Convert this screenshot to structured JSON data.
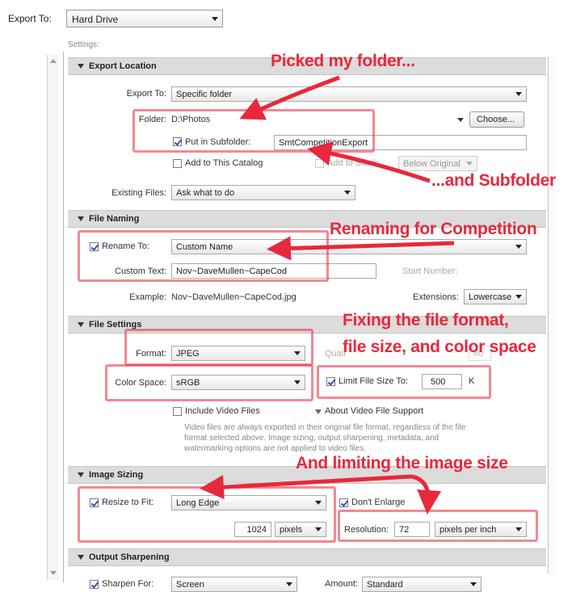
{
  "header": {
    "export_to_label": "Export To:",
    "export_to_value": "Hard Drive",
    "settings_label": "Settings:"
  },
  "sections": {
    "export_location": "Export Location",
    "file_naming": "File Naming",
    "file_settings": "File Settings",
    "image_sizing": "Image Sizing",
    "output_sharpening": "Output Sharpening"
  },
  "export_location": {
    "export_to_label": "Export To:",
    "export_to_value": "Specific folder",
    "folder_label": "Folder:",
    "folder_value": "D:\\Photos",
    "choose_button": "Choose...",
    "put_in_subfolder_label": "Put in Subfolder:",
    "subfolder_value": "SmtCompetitionExport",
    "add_to_catalog_label": "Add to This Catalog",
    "add_to_stack_label": "Add to Stack:",
    "below_original": "Below Original",
    "existing_files_label": "Existing Files:",
    "existing_files_value": "Ask what to do"
  },
  "file_naming": {
    "rename_to_label": "Rename To:",
    "rename_to_value": "Custom Name",
    "custom_text_label": "Custom Text:",
    "custom_text_value": "Nov~DaveMullen~CapeCod",
    "start_number_label": "Start Number:",
    "example_label": "Example:",
    "example_value": "Nov~DaveMullen~CapeCod.jpg",
    "extensions_label": "Extensions:",
    "extensions_value": "Lowercase"
  },
  "file_settings": {
    "format_label": "Format:",
    "format_value": "JPEG",
    "quality_label": "Quali",
    "quality_value": "60",
    "color_space_label": "Color Space:",
    "color_space_value": "sRGB",
    "limit_file_size_label": "Limit File Size To:",
    "limit_file_size_value": "500",
    "limit_unit": "K",
    "include_video_label": "Include Video Files",
    "about_video_label": "About Video File Support",
    "video_note": "Video files are always exported in their original file format, regardless of the file format selected above. Image sizing, output sharpening, metadata, and watermarking options are not applied to video files."
  },
  "image_sizing": {
    "resize_label": "Resize to Fit:",
    "resize_value": "Long Edge",
    "dont_enlarge_label": "Don't Enlarge",
    "size_value": "1024",
    "size_unit": "pixels",
    "resolution_label": "Resolution:",
    "resolution_value": "72",
    "resolution_unit": "pixels per inch"
  },
  "output_sharpening": {
    "sharpen_for_label": "Sharpen For:",
    "sharpen_for_value": "Screen",
    "amount_label": "Amount:",
    "amount_value": "Standard"
  },
  "annotations": {
    "picked_folder": "Picked my folder...",
    "and_subfolder": "...and Subfolder",
    "renaming": "Renaming for Competition",
    "fixing_line1": "Fixing the file format,",
    "fixing_line2": "file size, and color space",
    "limiting": "And limiting the image size"
  },
  "colors": {
    "annotation_red": "#e8283c",
    "section_header": "#dcdcdc"
  }
}
